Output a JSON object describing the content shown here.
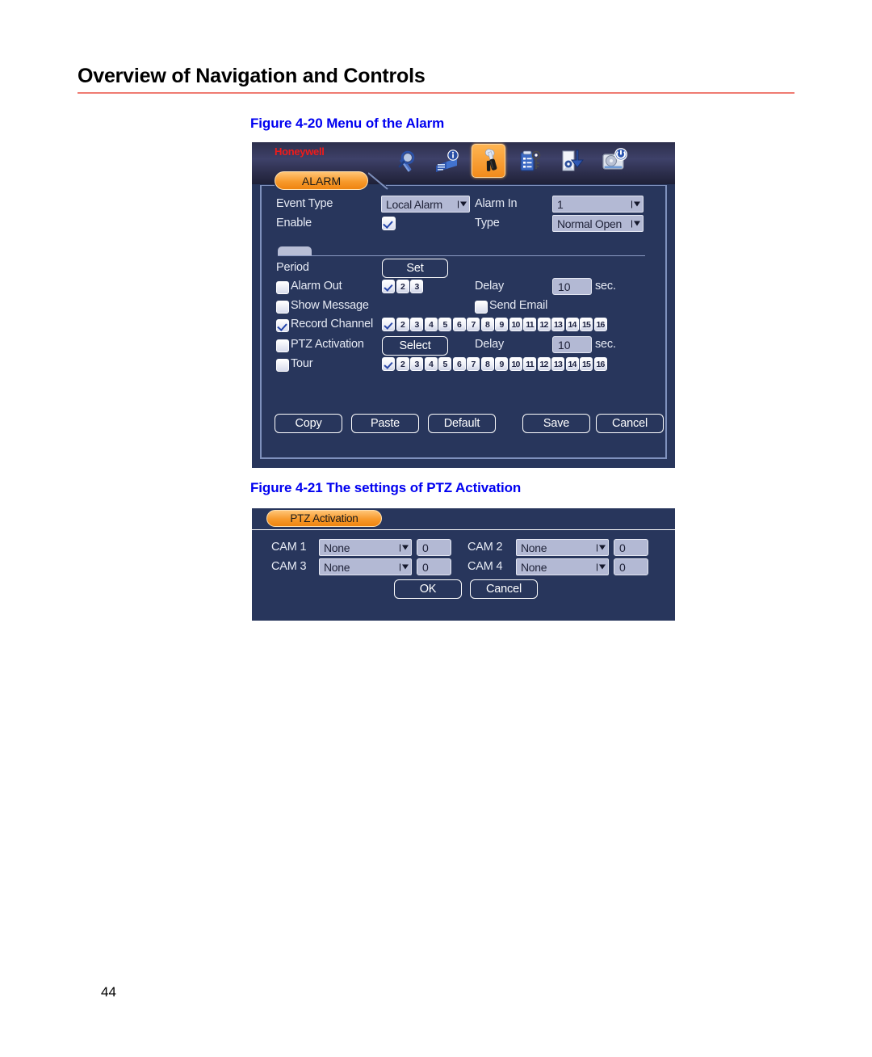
{
  "page": {
    "header_title": "Overview of Navigation and Controls",
    "page_number": "44",
    "rule_color": "#ef7b72",
    "caption_color": "#0000f0"
  },
  "figures": [
    {
      "caption": "Figure 4-20 Menu of the Alarm"
    },
    {
      "caption": "Figure 4-21 The settings of PTZ Activation"
    }
  ],
  "alarm_window": {
    "brand": "Honeywell",
    "brand_color": "#ee1b1b",
    "tab_label": "ALARM",
    "tab_color": "#f79a2c",
    "panel_bg": "#28365c",
    "toolbar_icons": [
      {
        "name": "search-icon",
        "selected": false
      },
      {
        "name": "info-book-icon",
        "selected": false
      },
      {
        "name": "tools-wrench-screwdriver-icon",
        "selected": true
      },
      {
        "name": "keys-checklist-icon",
        "selected": false
      },
      {
        "name": "backup-export-icon",
        "selected": false
      },
      {
        "name": "shutdown-hdd-icon",
        "selected": false
      }
    ],
    "fields": {
      "event_type_label": "Event Type",
      "event_type_value": "Local Alarm",
      "enable_label": "Enable",
      "enable_checked": true,
      "alarm_in_label": "Alarm In",
      "alarm_in_value": "1",
      "type_label": "Type",
      "type_value": "Normal Open"
    },
    "settings": {
      "period_label": "Period",
      "period_button": "Set",
      "alarm_out_label": "Alarm Out",
      "alarm_out_checked": false,
      "alarm_out_channels": [
        "1",
        "2",
        "3"
      ],
      "alarm_out_channel_checked": [
        true,
        false,
        false
      ],
      "alarm_out_delay_label": "Delay",
      "alarm_out_delay_value": "10",
      "alarm_out_delay_unit": "sec.",
      "show_message_label": "Show Message",
      "show_message_checked": false,
      "send_email_label": "Send Email",
      "send_email_checked": false,
      "record_channel_label": "Record Channel",
      "record_channel_checked": true,
      "record_channels": [
        "1",
        "2",
        "3",
        "4",
        "5",
        "6",
        "7",
        "8",
        "9",
        "10",
        "11",
        "12",
        "13",
        "14",
        "15",
        "16"
      ],
      "record_channel_checked_states": [
        true,
        false,
        false,
        false,
        false,
        false,
        false,
        false,
        false,
        false,
        false,
        false,
        false,
        false,
        false,
        false
      ],
      "ptz_activation_label": "PTZ Activation",
      "ptz_activation_checked": false,
      "ptz_select_button": "Select",
      "ptz_delay_label": "Delay",
      "ptz_delay_value": "10",
      "ptz_delay_unit": "sec.",
      "tour_label": "Tour",
      "tour_checked": false,
      "tour_channels": [
        "1",
        "2",
        "3",
        "4",
        "5",
        "6",
        "7",
        "8",
        "9",
        "10",
        "11",
        "12",
        "13",
        "14",
        "15",
        "16"
      ],
      "tour_channel_checked_states": [
        true,
        false,
        false,
        false,
        false,
        false,
        false,
        false,
        false,
        false,
        false,
        false,
        false,
        false,
        false,
        false
      ]
    },
    "buttons": {
      "copy": "Copy",
      "paste": "Paste",
      "default": "Default",
      "save": "Save",
      "cancel": "Cancel"
    }
  },
  "ptz_dialog": {
    "title": "PTZ Activation",
    "rows": [
      {
        "cam_label": "CAM 1",
        "action": "None",
        "value": "0"
      },
      {
        "cam_label": "CAM 2",
        "action": "None",
        "value": "0"
      },
      {
        "cam_label": "CAM 3",
        "action": "None",
        "value": "0"
      },
      {
        "cam_label": "CAM 4",
        "action": "None",
        "value": "0"
      }
    ],
    "ok_button": "OK",
    "cancel_button": "Cancel"
  }
}
